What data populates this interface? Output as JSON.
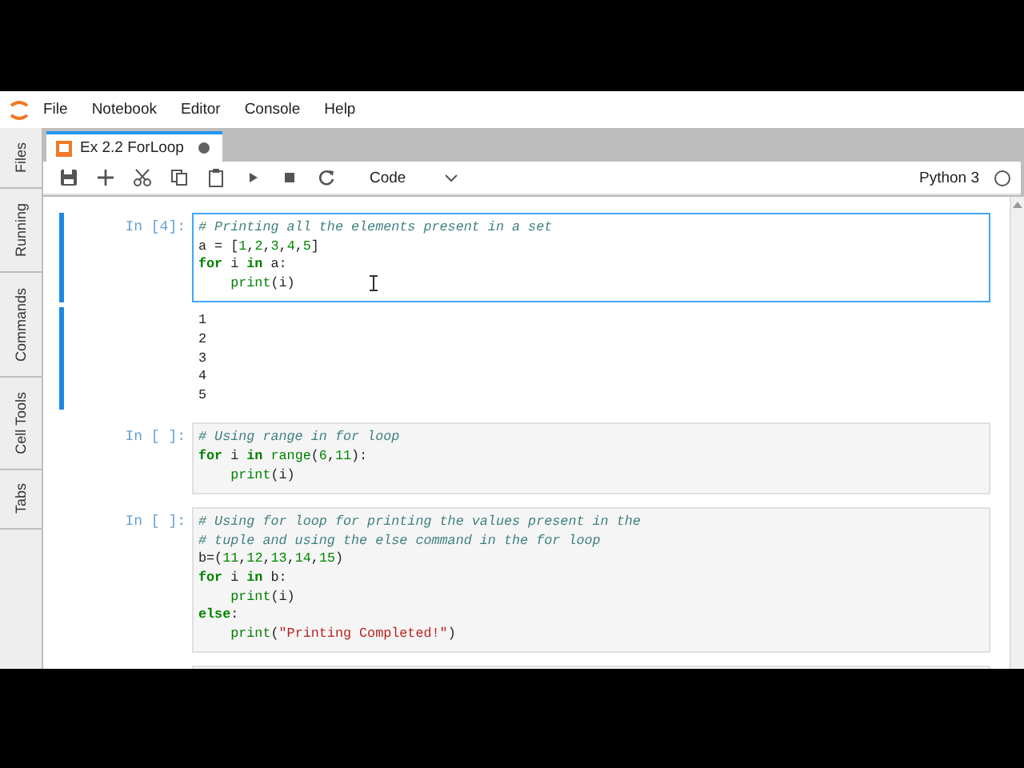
{
  "menu": [
    "File",
    "Notebook",
    "Editor",
    "Console",
    "Help"
  ],
  "sidebar": {
    "tabs": [
      {
        "label": "Files",
        "selected": false
      },
      {
        "label": "Running",
        "selected": false
      },
      {
        "label": "Commands",
        "selected": false
      },
      {
        "label": "Cell Tools",
        "selected": false
      },
      {
        "label": "Tabs",
        "selected": false
      }
    ]
  },
  "document_tab": {
    "title": "Ex 2.2 ForLoop",
    "selected": true,
    "modified": true
  },
  "toolbar": {
    "cell_type": "Code",
    "kernel": "Python 3",
    "kernel_busy": false
  },
  "cells": [
    {
      "prompt": "In [4]:",
      "selected": true,
      "editing": true,
      "lines": [
        {
          "indent": false,
          "tokens": [
            {
              "kind": "comment",
              "text": "# Printing all the elements present in a set"
            }
          ]
        },
        {
          "indent": false,
          "tokens": [
            {
              "kind": "plain",
              "text": "a = ["
            },
            {
              "kind": "number",
              "text": "1"
            },
            {
              "kind": "plain",
              "text": ","
            },
            {
              "kind": "number",
              "text": "2"
            },
            {
              "kind": "plain",
              "text": ","
            },
            {
              "kind": "number",
              "text": "3"
            },
            {
              "kind": "plain",
              "text": ","
            },
            {
              "kind": "number",
              "text": "4"
            },
            {
              "kind": "plain",
              "text": ","
            },
            {
              "kind": "number",
              "text": "5"
            },
            {
              "kind": "plain",
              "text": "]"
            }
          ]
        },
        {
          "indent": false,
          "tokens": [
            {
              "kind": "keyword",
              "text": "for"
            },
            {
              "kind": "plain",
              "text": " i "
            },
            {
              "kind": "keyword",
              "text": "in"
            },
            {
              "kind": "plain",
              "text": " a:"
            }
          ]
        },
        {
          "indent": true,
          "tokens": [
            {
              "kind": "builtin",
              "text": "print"
            },
            {
              "kind": "plain",
              "text": "(i)"
            }
          ]
        }
      ],
      "output": [
        "1",
        "2",
        "3",
        "4",
        "5"
      ]
    },
    {
      "prompt": "In [ ]:",
      "selected": false,
      "editing": false,
      "lines": [
        {
          "indent": false,
          "tokens": [
            {
              "kind": "comment",
              "text": "# Using range in for loop"
            }
          ]
        },
        {
          "indent": false,
          "tokens": [
            {
              "kind": "keyword",
              "text": "for"
            },
            {
              "kind": "plain",
              "text": " i "
            },
            {
              "kind": "keyword",
              "text": "in"
            },
            {
              "kind": "builtin",
              "text": " range"
            },
            {
              "kind": "plain",
              "text": "("
            },
            {
              "kind": "number",
              "text": "6"
            },
            {
              "kind": "plain",
              "text": ","
            },
            {
              "kind": "number",
              "text": "11"
            },
            {
              "kind": "plain",
              "text": "):"
            }
          ]
        },
        {
          "indent": true,
          "tokens": [
            {
              "kind": "builtin",
              "text": "print"
            },
            {
              "kind": "plain",
              "text": "(i)"
            }
          ]
        }
      ]
    },
    {
      "prompt": "In [ ]:",
      "selected": false,
      "editing": false,
      "lines": [
        {
          "indent": false,
          "tokens": [
            {
              "kind": "comment",
              "text": "# Using for loop for printing the values present in the"
            }
          ]
        },
        {
          "indent": false,
          "tokens": [
            {
              "kind": "comment",
              "text": "# tuple and using the else command in the for loop"
            }
          ]
        },
        {
          "indent": false,
          "tokens": [
            {
              "kind": "plain",
              "text": "b=("
            },
            {
              "kind": "number",
              "text": "11"
            },
            {
              "kind": "plain",
              "text": ","
            },
            {
              "kind": "number",
              "text": "12"
            },
            {
              "kind": "plain",
              "text": ","
            },
            {
              "kind": "number",
              "text": "13"
            },
            {
              "kind": "plain",
              "text": ","
            },
            {
              "kind": "number",
              "text": "14"
            },
            {
              "kind": "plain",
              "text": ","
            },
            {
              "kind": "number",
              "text": "15"
            },
            {
              "kind": "plain",
              "text": ")"
            }
          ]
        },
        {
          "indent": false,
          "tokens": [
            {
              "kind": "keyword",
              "text": "for"
            },
            {
              "kind": "plain",
              "text": " i "
            },
            {
              "kind": "keyword",
              "text": "in"
            },
            {
              "kind": "plain",
              "text": " b:"
            }
          ]
        },
        {
          "indent": true,
          "tokens": [
            {
              "kind": "builtin",
              "text": "print"
            },
            {
              "kind": "plain",
              "text": "(i)"
            }
          ]
        },
        {
          "indent": false,
          "tokens": [
            {
              "kind": "keyword",
              "text": "else"
            },
            {
              "kind": "plain",
              "text": ":"
            }
          ]
        },
        {
          "indent": true,
          "tokens": [
            {
              "kind": "builtin",
              "text": "print"
            },
            {
              "kind": "plain",
              "text": "("
            },
            {
              "kind": "string",
              "text": "\"Printing Completed!\""
            },
            {
              "kind": "plain",
              "text": ")"
            }
          ]
        }
      ]
    },
    {
      "selected": false,
      "editing": false
    }
  ]
}
